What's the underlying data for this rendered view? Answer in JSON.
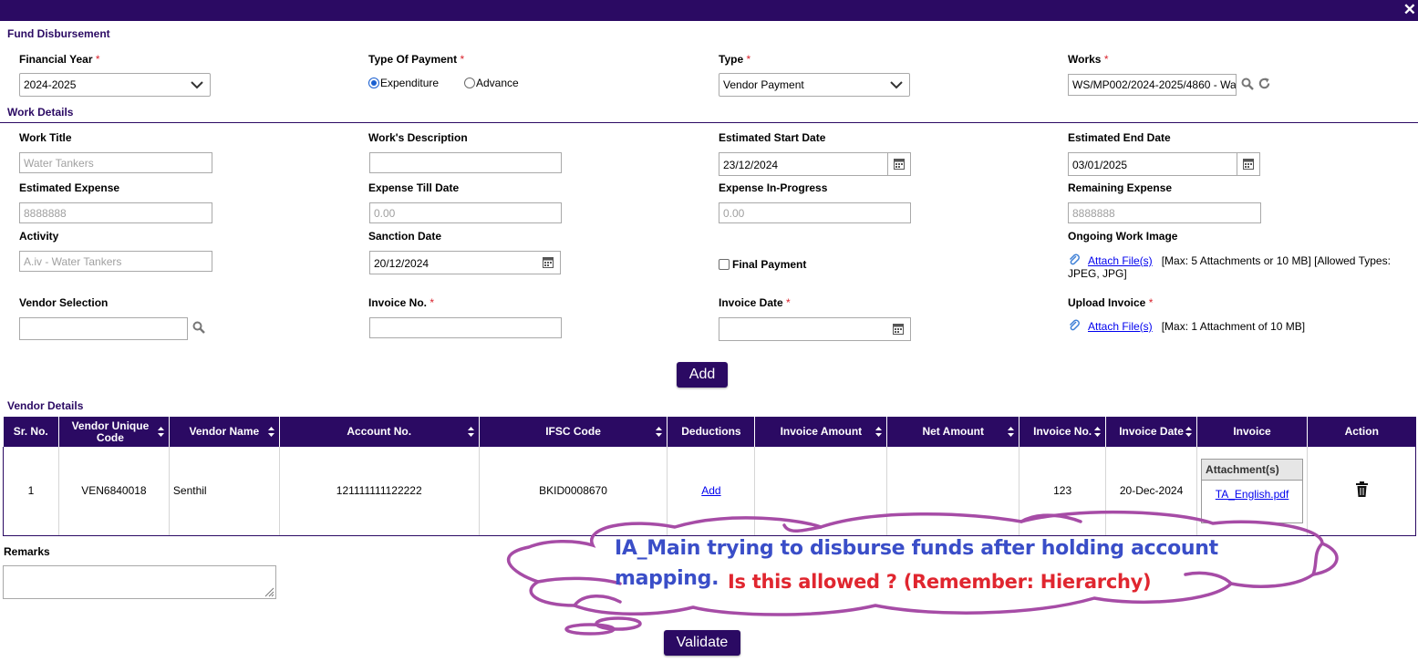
{
  "header": {
    "close_glyph": "✕"
  },
  "fund": {
    "title": "Fund Disbursement",
    "financial_year_label": "Financial Year",
    "financial_year_value": "2024-2025",
    "payment_type_label": "Type Of Payment",
    "payment_options": [
      "Expenditure",
      "Advance"
    ],
    "payment_selected": "Expenditure",
    "type_label": "Type",
    "type_value": "Vendor Payment",
    "works_label": "Works",
    "works_value": "WS/MP002/2024-2025/4860 - Wa",
    "required_mark": "*"
  },
  "work": {
    "title": "Work Details",
    "work_title_label": "Work Title",
    "work_title_value": "Water Tankers",
    "description_label": "Work's Description",
    "description_value": "",
    "est_start_label": "Estimated Start Date",
    "est_start_value": "23/12/2024",
    "est_end_label": "Estimated End Date",
    "est_end_value": "03/01/2025",
    "est_expense_label": "Estimated Expense",
    "est_expense_value": "8888888",
    "expense_till_label": "Expense Till Date",
    "expense_till_value": "0.00",
    "expense_progress_label": "Expense In-Progress",
    "expense_progress_value": "0.00",
    "remaining_label": "Remaining Expense",
    "remaining_value": "8888888",
    "activity_label": "Activity",
    "activity_value": "A.iv - Water Tankers",
    "sanction_label": "Sanction Date",
    "sanction_value": "20/12/2024",
    "final_payment_label": "Final Payment",
    "ongoing_image_label": "Ongoing Work Image",
    "attach_link": "Attach File(s)",
    "ongoing_attach_note": "[Max: 5 Attachments or 10 MB] [Allowed Types:",
    "ongoing_attach_note2": "JPEG, JPG]",
    "vendor_selection_label": "Vendor Selection",
    "invoice_no_label": "Invoice No.",
    "invoice_date_label": "Invoice Date",
    "upload_invoice_label": "Upload Invoice",
    "upload_attach_note": "[Max: 1 Attachment of 10 MB]",
    "add_button": "Add"
  },
  "vendor": {
    "title": "Vendor Details",
    "columns": [
      "Sr. No.",
      "Vendor Unique Code",
      "Vendor Name",
      "Account No.",
      "IFSC Code",
      "Deductions",
      "Invoice Amount",
      "Net Amount",
      "Invoice No.",
      "Invoice Date",
      "Invoice",
      "Action"
    ],
    "rows": [
      {
        "sr": "1",
        "code": "VEN6840018",
        "name": "Senthil",
        "account": "121111111122222",
        "ifsc": "BKID0008670",
        "deductions": "Add",
        "invoice_amount": "",
        "net_amount": "",
        "invoice_no": "123",
        "invoice_date": "20-Dec-2024",
        "attachment_header": "Attachment(s)",
        "attachment_file": "TA_English.pdf"
      }
    ]
  },
  "remarks": {
    "label": "Remarks",
    "value": ""
  },
  "validate_button": "Validate",
  "annotation": {
    "line1": "IA_Main trying to disburse funds after holding account",
    "line2": "mapping.",
    "line3": "Is this allowed ? (Remember: Hierarchy)",
    "cloud_color": "#a64ca6",
    "text_color": "#3a4ec8",
    "alert_color": "#e0262f"
  },
  "colors": {
    "brand": "#2b0a63",
    "required": "#d9232d",
    "link": "#0000ee"
  }
}
